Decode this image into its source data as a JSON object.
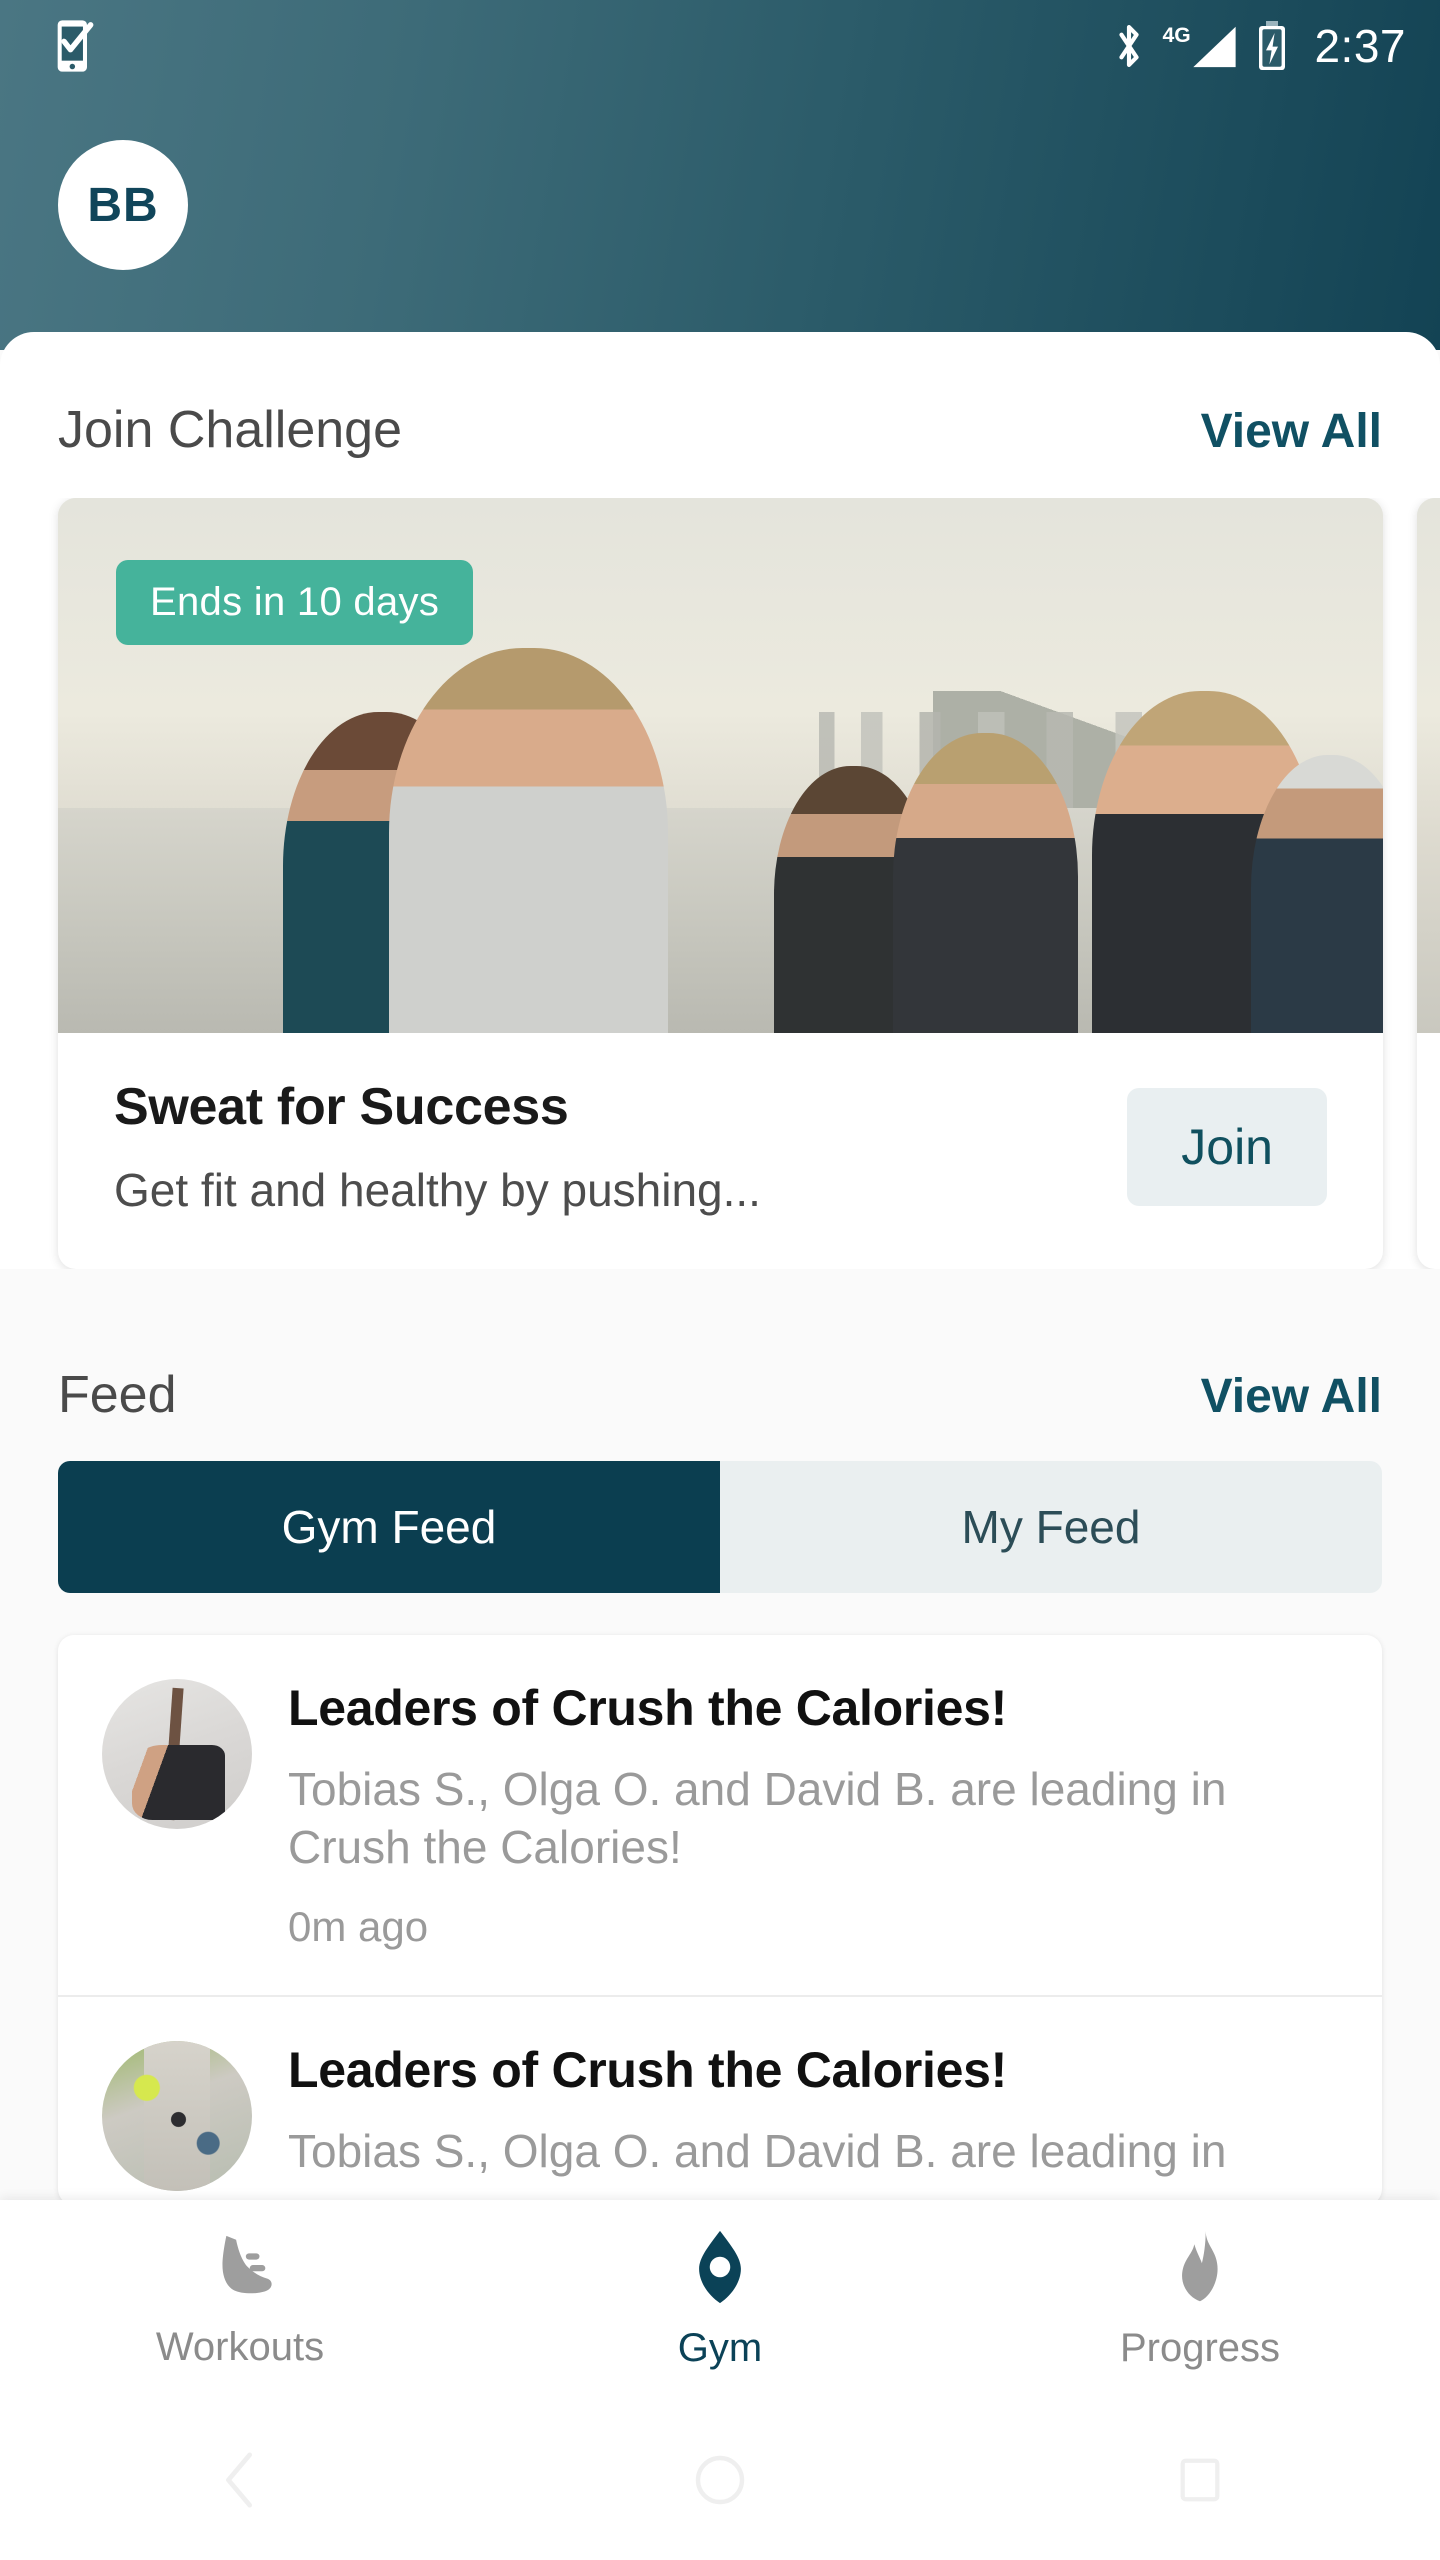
{
  "status_bar": {
    "left_icon": "phone-check-icon",
    "bluetooth_icon": "bluetooth-icon",
    "network_label": "4G",
    "signal_icon": "signal-bars-icon",
    "battery_icon": "battery-charging-icon",
    "time": "2:37"
  },
  "header": {
    "avatar_initials": "BB",
    "gradient_from": "#4a7683",
    "gradient_to": "#134354"
  },
  "challenge_section": {
    "title": "Join Challenge",
    "view_all_label": "View All",
    "cards": [
      {
        "badge": "Ends in 10 days",
        "title": "Sweat for Success",
        "subtitle": "Get fit and healthy by pushing...",
        "action_label": "Join",
        "image_alt": "group of people running along a waterfront at sunset"
      },
      {
        "badge": "",
        "title": "",
        "subtitle": "",
        "action_label": "",
        "image_alt": "next challenge card partially visible"
      }
    ]
  },
  "feed_section": {
    "title": "Feed",
    "view_all_label": "View All",
    "tabs": [
      {
        "label": "Gym Feed",
        "active": true
      },
      {
        "label": "My Feed",
        "active": false
      }
    ],
    "items": [
      {
        "title": "Leaders of Crush the Calories!",
        "description": "Tobias S., Olga O. and David B. are leading in Crush the Calories!",
        "time": "0m ago",
        "avatar_alt": "woman in a yoga triangle pose"
      },
      {
        "title": "Leaders of Crush the Calories!",
        "description": "Tobias S., Olga O. and David B. are leading in",
        "time": "",
        "avatar_alt": "three runners on a paved path"
      }
    ]
  },
  "bottom_nav": {
    "items": [
      {
        "label": "Workouts",
        "icon": "shoe-icon",
        "active": false
      },
      {
        "label": "Gym",
        "icon": "location-pin-icon",
        "active": true
      },
      {
        "label": "Progress",
        "icon": "flame-icon",
        "active": false
      }
    ],
    "active_color": "#0b4257",
    "inactive_color": "#9e9e9e"
  },
  "system_nav": {
    "back_icon": "back-chevron-icon",
    "home_icon": "home-circle-icon",
    "recents_icon": "recents-square-icon"
  }
}
